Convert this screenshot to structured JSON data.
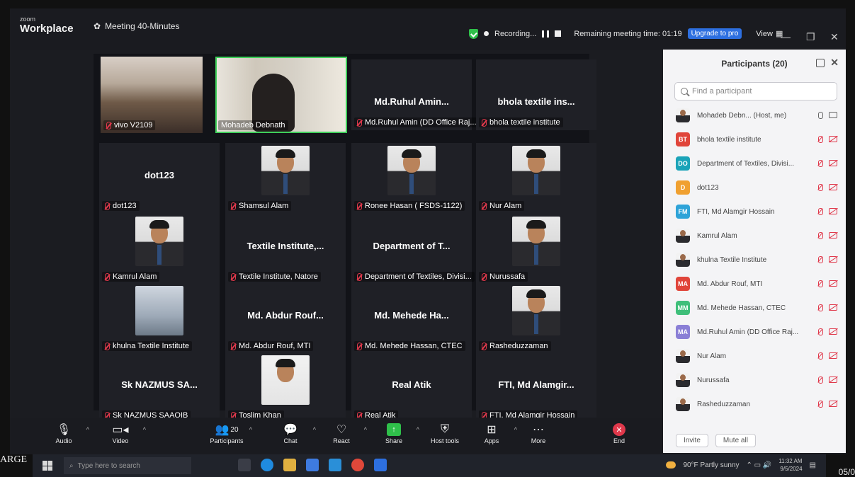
{
  "app": {
    "brand_small": "zoom",
    "brand_big": "Workplace",
    "meeting_title": "Meeting 40-Minutes"
  },
  "status": {
    "recording": "Recording...",
    "remaining": "Remaining meeting time: 01:19",
    "upgrade": "Upgrade to pro",
    "view": "View"
  },
  "tiles": [
    {
      "bigname": "",
      "label": "vivo V2109"
    },
    {
      "bigname": "",
      "label": "Mohadeb Debnath"
    },
    {
      "bigname": "Md.Ruhul Amin...",
      "label": "Md.Ruhul Amin (DD Office Raj..."
    },
    {
      "bigname": "bhola textile ins...",
      "label": "bhola textile institute"
    },
    {
      "bigname": "dot123",
      "label": "dot123"
    },
    {
      "bigname": "",
      "label": "Shamsul Alam"
    },
    {
      "bigname": "",
      "label": "Ronee Hasan ( FSDS-1122)"
    },
    {
      "bigname": "",
      "label": "Nur Alam"
    },
    {
      "bigname": "",
      "label": "Kamrul Alam"
    },
    {
      "bigname": "Textile Institute,...",
      "label": "Textile Institute, Natore"
    },
    {
      "bigname": "Department of T...",
      "label": "Department of Textiles, Divisi..."
    },
    {
      "bigname": "",
      "label": "Nurussafa"
    },
    {
      "bigname": "",
      "label": "khulna Textile Institute"
    },
    {
      "bigname": "Md. Abdur Rouf...",
      "label": "Md. Abdur Rouf, MTI"
    },
    {
      "bigname": "Md. Mehede Ha...",
      "label": "Md. Mehede Hassan, CTEC"
    },
    {
      "bigname": "",
      "label": "Rasheduzzaman"
    },
    {
      "bigname": "Sk NAZMUS SA...",
      "label": "Sk NAZMUS SAAQIB"
    },
    {
      "bigname": "",
      "label": "Toslim Khan"
    },
    {
      "bigname": "Real Atik",
      "label": "Real Atik"
    },
    {
      "bigname": "FTI, Md Alamgir...",
      "label": "FTI, Md Alamgir Hossain"
    }
  ],
  "panel": {
    "title": "Participants (20)",
    "search_placeholder": "Find a participant",
    "participants": [
      {
        "initials": "",
        "color": "",
        "name": "Mohadeb Debn... (Host, me)"
      },
      {
        "initials": "BT",
        "color": "#e0453a",
        "name": "bhola textile institute"
      },
      {
        "initials": "DO",
        "color": "#1aa3b8",
        "name": "Department of Textiles, Divisi..."
      },
      {
        "initials": "D",
        "color": "#f0a030",
        "name": "dot123"
      },
      {
        "initials": "FM",
        "color": "#2ea3d8",
        "name": "FTI, Md Alamgir Hossain"
      },
      {
        "initials": "",
        "color": "",
        "name": "Kamrul Alam"
      },
      {
        "initials": "",
        "color": "",
        "name": "khulna Textile Institute"
      },
      {
        "initials": "MA",
        "color": "#e0453a",
        "name": "Md. Abdur Rouf, MTI"
      },
      {
        "initials": "MM",
        "color": "#3fbf7a",
        "name": "Md. Mehede Hassan, CTEC"
      },
      {
        "initials": "MA",
        "color": "#8a7fd6",
        "name": "Md.Ruhul Amin (DD Office Raj..."
      },
      {
        "initials": "",
        "color": "",
        "name": "Nur Alam"
      },
      {
        "initials": "",
        "color": "",
        "name": "Nurussafa"
      },
      {
        "initials": "",
        "color": "",
        "name": "Rasheduzzaman"
      }
    ],
    "invite": "Invite",
    "mute_all": "Mute all"
  },
  "toolbar": {
    "audio": "Audio",
    "video": "Video",
    "participants": "Participants",
    "participants_count": "20",
    "chat": "Chat",
    "react": "React",
    "share": "Share",
    "host_tools": "Host tools",
    "apps": "Apps",
    "more": "More",
    "end": "End"
  },
  "taskbar": {
    "search_placeholder": "Type here to search",
    "weather": "90°F  Partly sunny",
    "time": "11:32 AM",
    "date": "9/5/2024"
  },
  "edge": {
    "left": "ARGE",
    "right": "05/0"
  }
}
